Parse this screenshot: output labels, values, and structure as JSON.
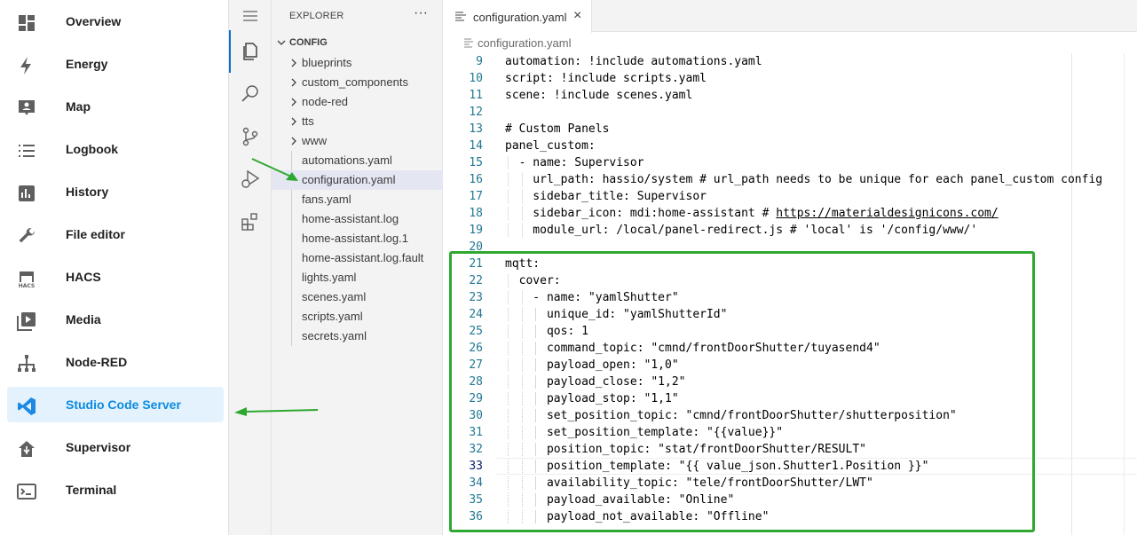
{
  "ha_sidebar": {
    "items": [
      {
        "label": "Overview",
        "icon": "dashboard-icon"
      },
      {
        "label": "Energy",
        "icon": "lightning-bolt-icon"
      },
      {
        "label": "Map",
        "icon": "map-account-icon"
      },
      {
        "label": "Logbook",
        "icon": "format-list-icon"
      },
      {
        "label": "History",
        "icon": "chart-box-icon"
      },
      {
        "label": "File editor",
        "icon": "wrench-icon"
      },
      {
        "label": "HACS",
        "icon": "hacs-store-icon",
        "icon_text": "HACS"
      },
      {
        "label": "Media",
        "icon": "play-box-multiple-icon"
      },
      {
        "label": "Node-RED",
        "icon": "sitemap-icon"
      },
      {
        "label": "Studio Code Server",
        "icon": "vscode-icon",
        "selected": true
      },
      {
        "label": "Supervisor",
        "icon": "home-assistant-icon"
      },
      {
        "label": "Terminal",
        "icon": "console-icon"
      }
    ]
  },
  "explorer": {
    "title": "EXPLORER",
    "more": "···",
    "root": "CONFIG",
    "folders": [
      "blueprints",
      "custom_components",
      "node-red",
      "tts",
      "www"
    ],
    "files": [
      "automations.yaml",
      "configuration.yaml",
      "fans.yaml",
      "home-assistant.log",
      "home-assistant.log.1",
      "home-assistant.log.fault",
      "lights.yaml",
      "scenes.yaml",
      "scripts.yaml",
      "secrets.yaml"
    ],
    "selected_file": "configuration.yaml"
  },
  "editor": {
    "tab_label": "configuration.yaml",
    "tab_close": "×",
    "breadcrumb": "configuration.yaml",
    "current_line": 33,
    "lines": [
      {
        "n": "9",
        "text": "automation: !include automations.yaml"
      },
      {
        "n": "10",
        "text": "script: !include scripts.yaml"
      },
      {
        "n": "11",
        "text": "scene: !include scenes.yaml"
      },
      {
        "n": "12",
        "text": ""
      },
      {
        "n": "13",
        "text": "# Custom Panels"
      },
      {
        "n": "14",
        "text": "panel_custom:"
      },
      {
        "n": "15",
        "text": "  - name: Supervisor"
      },
      {
        "n": "16",
        "text": "    url_path: hassio/system # url_path needs to be unique for each panel_custom config"
      },
      {
        "n": "17",
        "text": "    sidebar_title: Supervisor"
      },
      {
        "n": "18",
        "text": "    sidebar_icon: mdi:home-assistant # ",
        "url": "https://materialdesignicons.com/"
      },
      {
        "n": "19",
        "text": "    module_url: /local/panel-redirect.js # 'local' is '/config/www/'"
      },
      {
        "n": "20",
        "text": ""
      },
      {
        "n": "21",
        "text": "mqtt:"
      },
      {
        "n": "22",
        "text": "  cover:"
      },
      {
        "n": "23",
        "text": "    - name: \"yamlShutter\""
      },
      {
        "n": "24",
        "text": "      unique_id: \"yamlShutterId\""
      },
      {
        "n": "25",
        "text": "      qos: 1"
      },
      {
        "n": "26",
        "text": "      command_topic: \"cmnd/frontDoorShutter/tuyasend4\""
      },
      {
        "n": "27",
        "text": "      payload_open: \"1,0\""
      },
      {
        "n": "28",
        "text": "      payload_close: \"1,2\""
      },
      {
        "n": "29",
        "text": "      payload_stop: \"1,1\""
      },
      {
        "n": "30",
        "text": "      set_position_topic: \"cmnd/frontDoorShutter/shutterposition\""
      },
      {
        "n": "31",
        "text": "      set_position_template: \"{{value}}\""
      },
      {
        "n": "32",
        "text": "      position_topic: \"stat/frontDoorShutter/RESULT\""
      },
      {
        "n": "33",
        "text": "      position_template: \"{{ value_json.Shutter1.Position }}\""
      },
      {
        "n": "34",
        "text": "      availability_topic: \"tele/frontDoorShutter/LWT\""
      },
      {
        "n": "35",
        "text": "      payload_available: \"Online\""
      },
      {
        "n": "36",
        "text": "      payload_not_available: \"Offline\""
      }
    ]
  },
  "colors": {
    "accent": "#0d8ae0",
    "annotation_green": "#2fa831",
    "line_number": "#237893"
  }
}
